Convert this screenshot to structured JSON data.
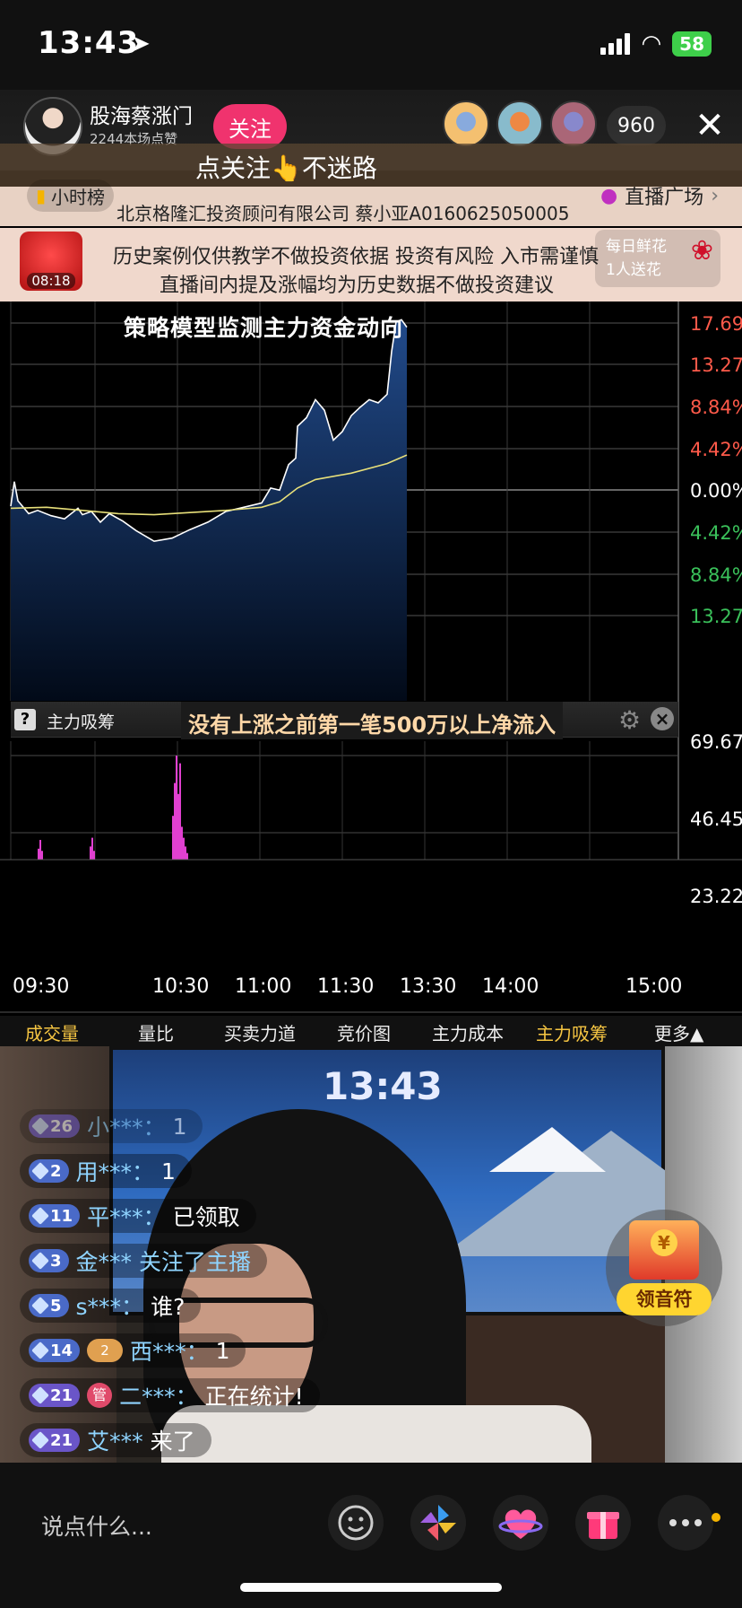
{
  "status_bar": {
    "time": "13:43",
    "battery": "58"
  },
  "host": {
    "name": "股海蔡涨门",
    "likes": "2244本场点赞",
    "follow_label": "关注",
    "viewer_count": "960"
  },
  "banner": {
    "follow_tip": "点关注👆不迷路",
    "hourly_rank": "小时榜",
    "plaza": "直播广场",
    "company_line": "北京格隆汇投资顾问有限公司 蔡小亚A0160625050005",
    "disclaimer_line1": "历史案例仅供教学不做投资依据 投资有风险 入市需谨慎",
    "disclaimer_line2": "直播间内提及涨幅均为历史数据不做投资建议",
    "lucky_timer": "08:18",
    "flower_line1": "每日鲜花",
    "flower_line2": "1人送花"
  },
  "chart_title": "策略模型监测主力资金动向",
  "indicator": {
    "name": "主力吸筹",
    "caption": "没有上涨之前第一笔500万以上净流入"
  },
  "tabs": [
    "成交量",
    "量比",
    "买卖力道",
    "竞价图",
    "主力成本",
    "主力吸筹",
    "更多▲"
  ],
  "chat": [
    {
      "level": "26",
      "user": "小***：",
      "text": "1",
      "badge_color": "#6a55c8"
    },
    {
      "level": "2",
      "user": "用***：",
      "text": "1",
      "badge_color": "#4a6ac8"
    },
    {
      "level": "11",
      "user": "平***：",
      "text": "已领取",
      "badge_color": "#4a6ac8"
    },
    {
      "level": "3",
      "user": "金***",
      "text": "关注了主播",
      "badge_color": "#4a6ac8"
    },
    {
      "level": "5",
      "user": "s***：",
      "text": "谁?",
      "badge_color": "#4a6ac8"
    },
    {
      "level": "14",
      "user": "西***：",
      "text": "1",
      "badge_color": "#4a6ac8",
      "heart": "2"
    },
    {
      "level": "21",
      "user": "二***：",
      "text": "正在统计!",
      "badge_color": "#6a55c8",
      "manager": "管"
    },
    {
      "level": "21",
      "user": "艾***",
      "text": "来了",
      "badge_color": "#6a55c8"
    }
  ],
  "video": {
    "monitor_time": "13:43"
  },
  "chest": {
    "label": "领音符"
  },
  "bottom": {
    "input_placeholder": "说点什么..."
  },
  "chart_data": {
    "type": "line",
    "x_ticks": [
      "09:30",
      "10:30",
      "11:00",
      "11:30",
      "13:30",
      "14:00",
      "15:00"
    ],
    "price_pct_axis": [
      "17.69",
      "13.27",
      "8.84%",
      "4.42%",
      "0.00%",
      "4.42%",
      "8.84%",
      "13.27"
    ],
    "volume_axis": [
      "69.67",
      "46.45",
      "23.22"
    ],
    "price_line": [
      [
        0,
        0.5
      ],
      [
        4,
        2.8
      ],
      [
        8,
        1.0
      ],
      [
        20,
        -0.2
      ],
      [
        30,
        0.1
      ],
      [
        45,
        -0.4
      ],
      [
        60,
        -0.7
      ],
      [
        75,
        0.3
      ],
      [
        80,
        -0.3
      ],
      [
        90,
        0
      ],
      [
        100,
        -1.0
      ],
      [
        110,
        -0.2
      ],
      [
        125,
        -0.9
      ],
      [
        140,
        -1.8
      ],
      [
        160,
        -2.8
      ],
      [
        180,
        -2.5
      ],
      [
        200,
        -1.7
      ],
      [
        220,
        -1.0
      ],
      [
        240,
        0.0
      ],
      [
        260,
        0.4
      ],
      [
        280,
        0.8
      ],
      [
        290,
        2.2
      ],
      [
        300,
        2.0
      ],
      [
        310,
        4.4
      ],
      [
        318,
        5.0
      ],
      [
        320,
        8.0
      ],
      [
        330,
        8.8
      ],
      [
        340,
        10.5
      ],
      [
        350,
        9.5
      ],
      [
        360,
        6.7
      ],
      [
        370,
        7.5
      ],
      [
        380,
        9.0
      ],
      [
        390,
        9.8
      ],
      [
        400,
        10.5
      ],
      [
        410,
        10.2
      ],
      [
        420,
        11.0
      ],
      [
        425,
        15.0
      ],
      [
        430,
        17.8
      ],
      [
        436,
        18.0
      ],
      [
        442,
        17.3
      ]
    ],
    "avg_line": [
      [
        0,
        0.3
      ],
      [
        40,
        0.4
      ],
      [
        80,
        0.1
      ],
      [
        120,
        -0.2
      ],
      [
        160,
        -0.3
      ],
      [
        200,
        -0.1
      ],
      [
        240,
        0.1
      ],
      [
        280,
        0.4
      ],
      [
        300,
        0.9
      ],
      [
        320,
        2.2
      ],
      [
        340,
        3.0
      ],
      [
        380,
        3.6
      ],
      [
        420,
        4.5
      ],
      [
        442,
        5.3
      ]
    ],
    "volume_bars": [
      [
        30,
        10
      ],
      [
        32,
        18
      ],
      [
        34,
        8
      ],
      [
        88,
        12
      ],
      [
        90,
        20
      ],
      [
        92,
        8
      ],
      [
        180,
        40
      ],
      [
        182,
        70
      ],
      [
        184,
        95
      ],
      [
        186,
        60
      ],
      [
        188,
        88
      ],
      [
        190,
        30
      ],
      [
        192,
        20
      ],
      [
        194,
        12
      ],
      [
        196,
        6
      ]
    ],
    "colors": {
      "price": "#ffffff",
      "avg": "#e8e07a",
      "area_top": "#214a8a",
      "volume": "#e040d0",
      "axis_up": "#ff5a4a",
      "axis_down": "#3ac05a"
    }
  }
}
